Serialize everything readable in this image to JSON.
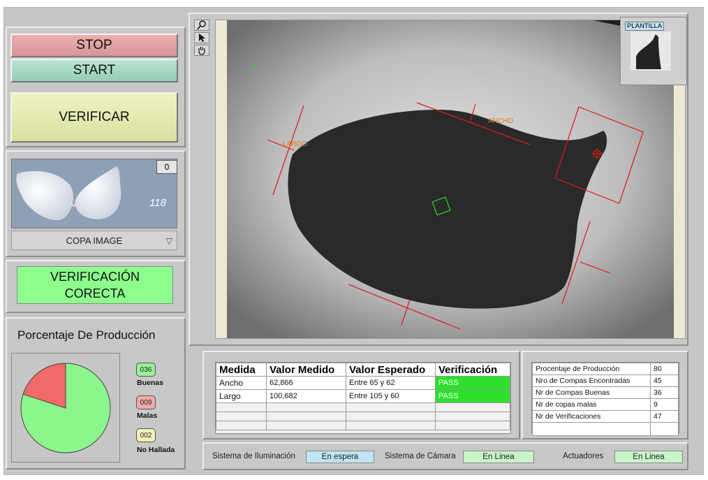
{
  "controls": {
    "stop_label": "STOP",
    "start_label": "START",
    "verify_label": "VERIFICAR"
  },
  "cup_panel": {
    "counter": "0",
    "image_number": "118",
    "selector_value": "COPA IMAGE"
  },
  "verification": {
    "line1": "VERIFICACIÓN",
    "line2": "CORECTA",
    "color": "#8cff8c"
  },
  "production": {
    "title": "Porcentaje De Producción",
    "pie": {
      "good_fraction": 0.8,
      "bad_fraction": 0.2,
      "good_color": "#8cf58c",
      "bad_color": "#f26a6a"
    },
    "legend": [
      {
        "value": "036",
        "label": "Buenas",
        "color": "#9af09a"
      },
      {
        "value": "009",
        "label": "Malas",
        "color": "#f2a8a8"
      },
      {
        "value": "002",
        "label": "No Hallada",
        "color": "#f3f0b8"
      }
    ]
  },
  "viewer": {
    "tools": [
      "zoom-icon",
      "pointer-icon",
      "pan-hand-icon"
    ],
    "template_label": "PLANTILLA",
    "annotations": {
      "width_label": "ANCHO",
      "length_label": "LARGO"
    }
  },
  "measurements": {
    "headers": [
      "Medida",
      "Valor Medido",
      "Valor Esperado",
      "Verificación"
    ],
    "rows": [
      {
        "medida": "Ancho",
        "medido": "62,866",
        "esperado": "Entre 65 y 62",
        "verificacion": "PASS"
      },
      {
        "medida": "Largo",
        "medido": "100,682",
        "esperado": "Entre 105 y 60",
        "verificacion": "PASS"
      }
    ]
  },
  "stats": {
    "rows": [
      {
        "label": "Procentaje de Producción",
        "value": "80"
      },
      {
        "label": "Nro de Compas Encontradas",
        "value": "45"
      },
      {
        "label": "Nr de Compas Buenas",
        "value": "36"
      },
      {
        "label": "Nr de copas malas",
        "value": "9"
      },
      {
        "label": "Nr de Verificaciones",
        "value": "47"
      }
    ]
  },
  "status_bar": {
    "lighting_label": "Sistema de Iluminación",
    "lighting_value": "En espera",
    "lighting_color": "#bfe4f4",
    "camera_label": "Sistema de Cámara",
    "camera_value": "En Linea",
    "camera_color": "#c9f4c9",
    "actuators_label": "Actuadores",
    "actuators_value": "En Linea",
    "actuators_color": "#c9f4c9"
  }
}
